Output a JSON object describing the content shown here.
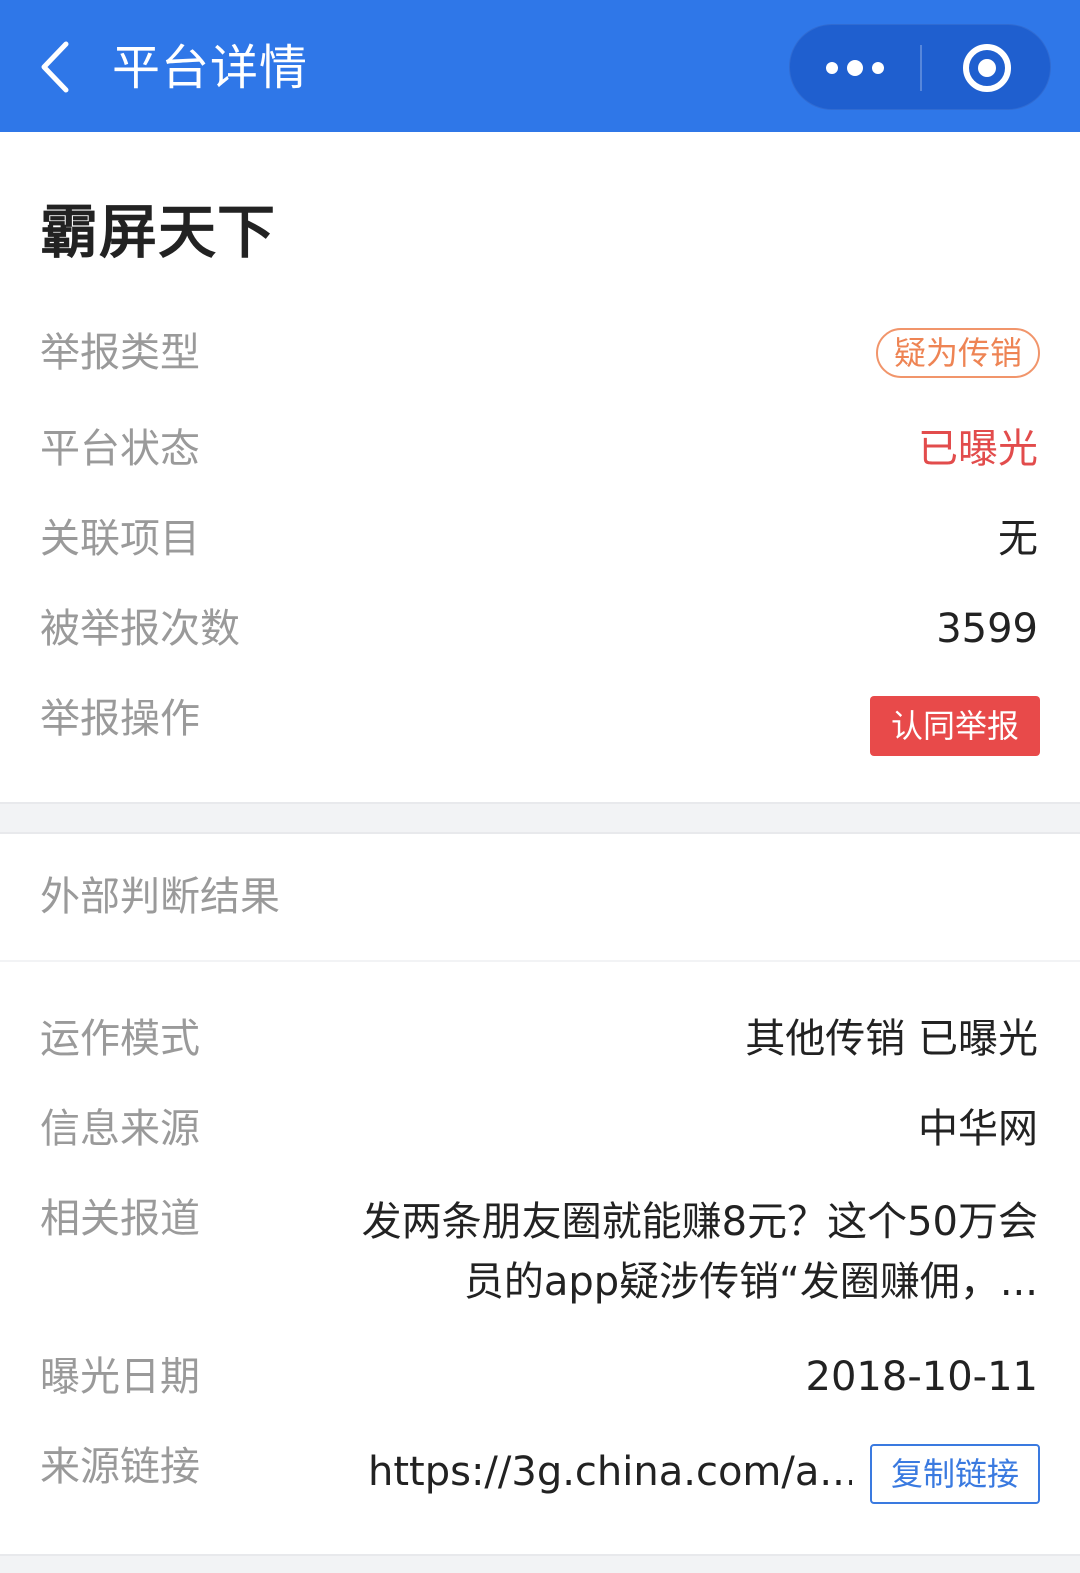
{
  "header": {
    "title": "平台详情"
  },
  "platform": {
    "name": "霸屏天下"
  },
  "basic_info": {
    "report_type_label": "举报类型",
    "report_type_value": "疑为传销",
    "status_label": "平台状态",
    "status_value": "已曝光",
    "related_label": "关联项目",
    "related_value": "无",
    "count_label": "被举报次数",
    "count_value": "3599",
    "action_label": "举报操作",
    "action_button": "认同举报"
  },
  "external": {
    "section_title": "外部判断结果",
    "mode_label": "运作模式",
    "mode_value": "其他传销 已曝光",
    "source_label": "信息来源",
    "source_value": "中华网",
    "report_label": "相关报道",
    "report_value": "发两条朋友圈就能赚8元？这个50万会员的app疑涉传销“发圈赚佣，...",
    "date_label": "曝光日期",
    "date_value": "2018-10-11",
    "link_label": "来源链接",
    "link_value": "https://3g.china.com/a...",
    "copy_button": "复制链接"
  },
  "colors": {
    "header_bg": "#2f77e8",
    "capsule_bg": "#1f5fcf",
    "danger": "#e84a4a",
    "badge_orange": "#ee8454",
    "link_blue": "#3a7ae0"
  },
  "icons": {
    "back": "chevron-left-icon",
    "more": "more-dots-icon",
    "close": "target-circle-icon"
  }
}
